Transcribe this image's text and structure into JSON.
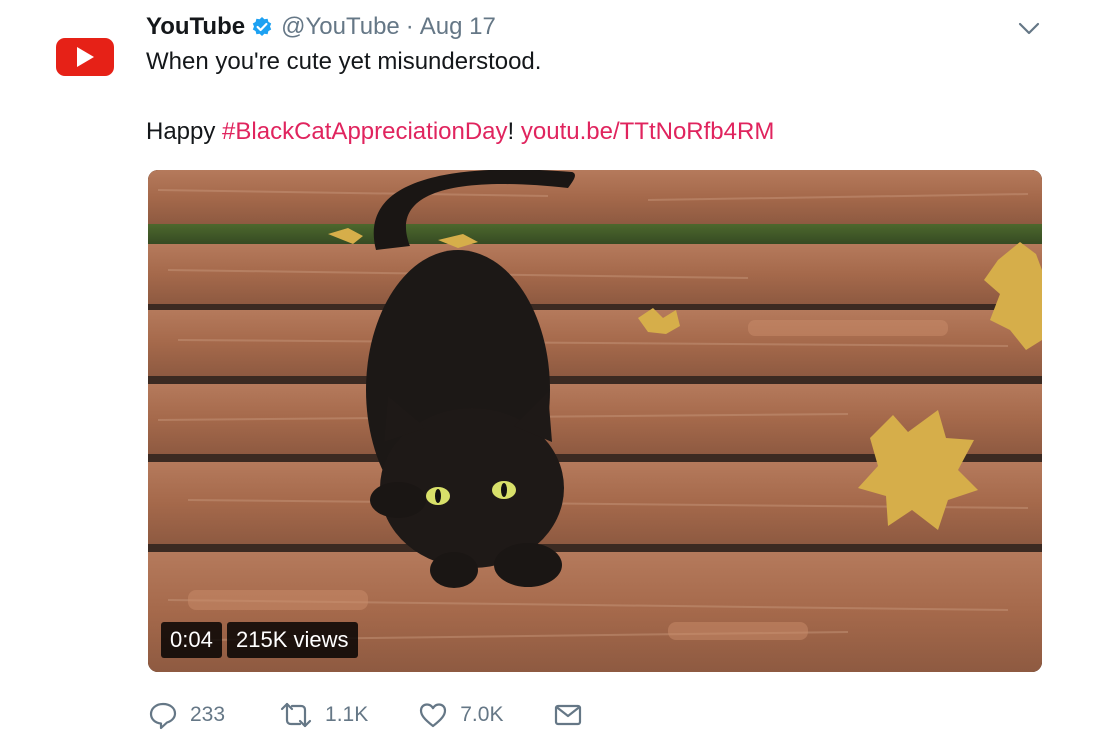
{
  "tweet": {
    "display_name": "YouTube",
    "handle": "@YouTube",
    "separator": "·",
    "date": "Aug 17",
    "text_line1": "When you're cute yet misunderstood.",
    "text_prefix": "Happy ",
    "hashtag": "#BlackCatAppreciationDay",
    "text_mid": "! ",
    "link": "youtu.be/TTtNoRfb4RM"
  },
  "media": {
    "duration": "0:04",
    "views": "215K views"
  },
  "actions": {
    "replies": "233",
    "retweets": "1.1K",
    "likes": "7.0K"
  },
  "icons": {
    "avatar": "youtube-play-logo",
    "verified": "verified-badge-icon",
    "caret": "chevron-down-icon",
    "reply": "reply-icon",
    "retweet": "retweet-icon",
    "like": "heart-icon",
    "dm": "envelope-icon"
  },
  "colors": {
    "brand_red": "#e62117",
    "link": "#e0245e",
    "muted": "#657786",
    "verified": "#1da1f2"
  }
}
